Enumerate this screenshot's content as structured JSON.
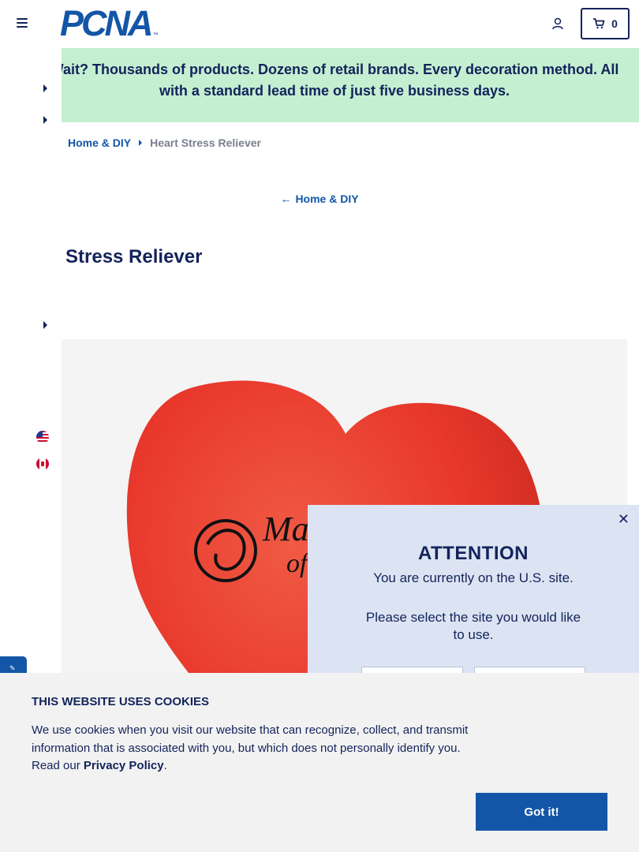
{
  "header": {
    "logo_text": "PCNA",
    "logo_tm": "™",
    "cart_count": "0"
  },
  "promo": {
    "text": "Wait? Thousands of products. Dozens of retail brands. Every decoration method. All with a standard lead time of just five business days."
  },
  "breadcrumb": {
    "parent": "Home & DIY",
    "current": "Heart Stress Reliever"
  },
  "back_link": {
    "label": "Home & DIY"
  },
  "product": {
    "title": "Stress Reliever",
    "imprint_text": "Ma",
    "imprint_text2": "of"
  },
  "site_modal": {
    "title": "ATTENTION",
    "message": "You are currently on the U.S. site.",
    "prompt": "Please select the site you would like to use."
  },
  "cookie_banner": {
    "title": "THIS WEBSITE USES COOKIES",
    "text": "We use cookies when you visit our website that can recognize, collect, and transmit information that is associated with you, but which does not personally identify you. Read our ",
    "link": "Privacy Policy",
    "text_end": ".",
    "button": "Got it!"
  },
  "colors": {
    "navy": "#13235b",
    "blue": "#1356a7",
    "promo_bg": "#c4efd1",
    "modal_bg": "#dce4f3",
    "heart_red": "#e8372b"
  }
}
